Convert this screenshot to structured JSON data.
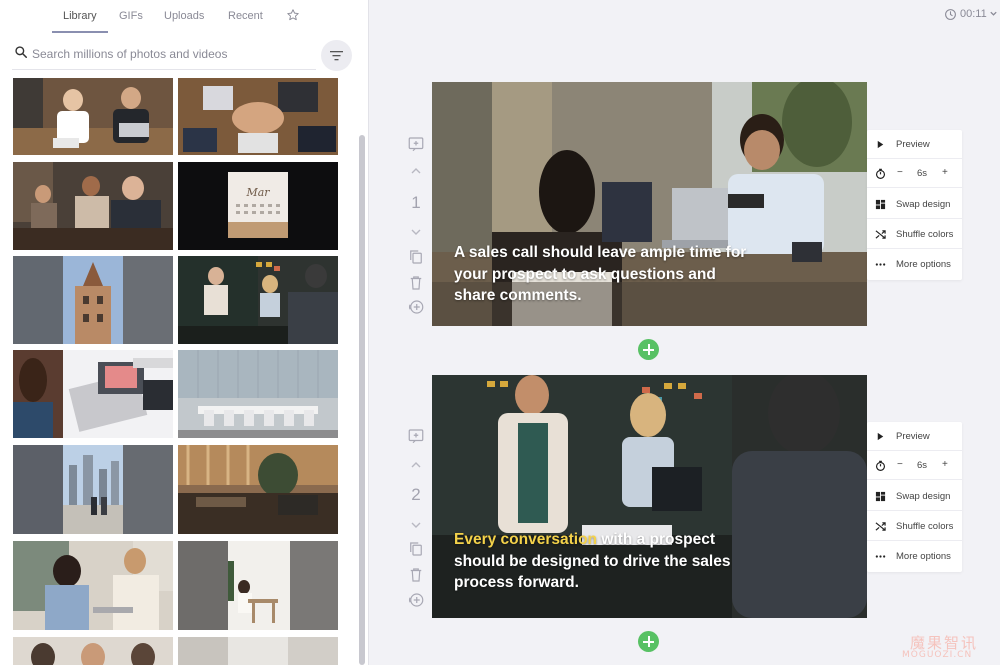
{
  "library": {
    "tabs": [
      {
        "label": "Library",
        "active": true
      },
      {
        "label": "GIFs",
        "active": false
      },
      {
        "label": "Uploads",
        "active": false
      },
      {
        "label": "Recent",
        "active": false
      }
    ],
    "favorites_icon": "star-icon",
    "search": {
      "placeholder": "Search millions of photos and videos",
      "value": ""
    },
    "filter_icon": "filter-icon",
    "thumbnails": [
      {
        "name": "business-meeting-laptops"
      },
      {
        "name": "hands-stacked-teamwork"
      },
      {
        "name": "office-group-discussion"
      },
      {
        "name": "desk-calendar"
      },
      {
        "name": "historic-building"
      },
      {
        "name": "presentation-meeting"
      },
      {
        "name": "woman-using-laptop"
      },
      {
        "name": "empty-conference-room"
      },
      {
        "name": "city-skyline-walkers"
      },
      {
        "name": "open-office-lounge"
      },
      {
        "name": "women-with-laptop"
      },
      {
        "name": "cafe-interior"
      },
      {
        "name": "office-people-row-partial"
      },
      {
        "name": "office-room-partial"
      }
    ]
  },
  "editor": {
    "timer": "00:11",
    "slides": [
      {
        "number": "1",
        "caption_lines": [
          [
            {
              "text": "A sales call should leave ample time for",
              "highlight": false
            }
          ],
          [
            {
              "text": "your prospect to ask questions and",
              "highlight": false
            }
          ],
          [
            {
              "text": "share comments.",
              "highlight": false
            }
          ]
        ],
        "duration": "6s"
      },
      {
        "number": "2",
        "caption_lines": [
          [
            {
              "text": "Every conversation",
              "highlight": true
            },
            {
              "text": " with a prospect",
              "highlight": false
            }
          ],
          [
            {
              "text": "should be designed to drive the sales",
              "highlight": false
            }
          ],
          [
            {
              "text": "process forward.",
              "highlight": false
            }
          ]
        ],
        "duration": "6s"
      }
    ],
    "menu": {
      "preview": "Preview",
      "minus": "−",
      "plus": "+",
      "swap_design": "Swap design",
      "shuffle_colors": "Shuffle colors",
      "more_options": "More options"
    },
    "colors": {
      "accent": "#58c164",
      "highlight": "#f4d24a"
    }
  },
  "watermark": {
    "cn": "魔果智讯",
    "en": "MOGUOZI.CN"
  }
}
